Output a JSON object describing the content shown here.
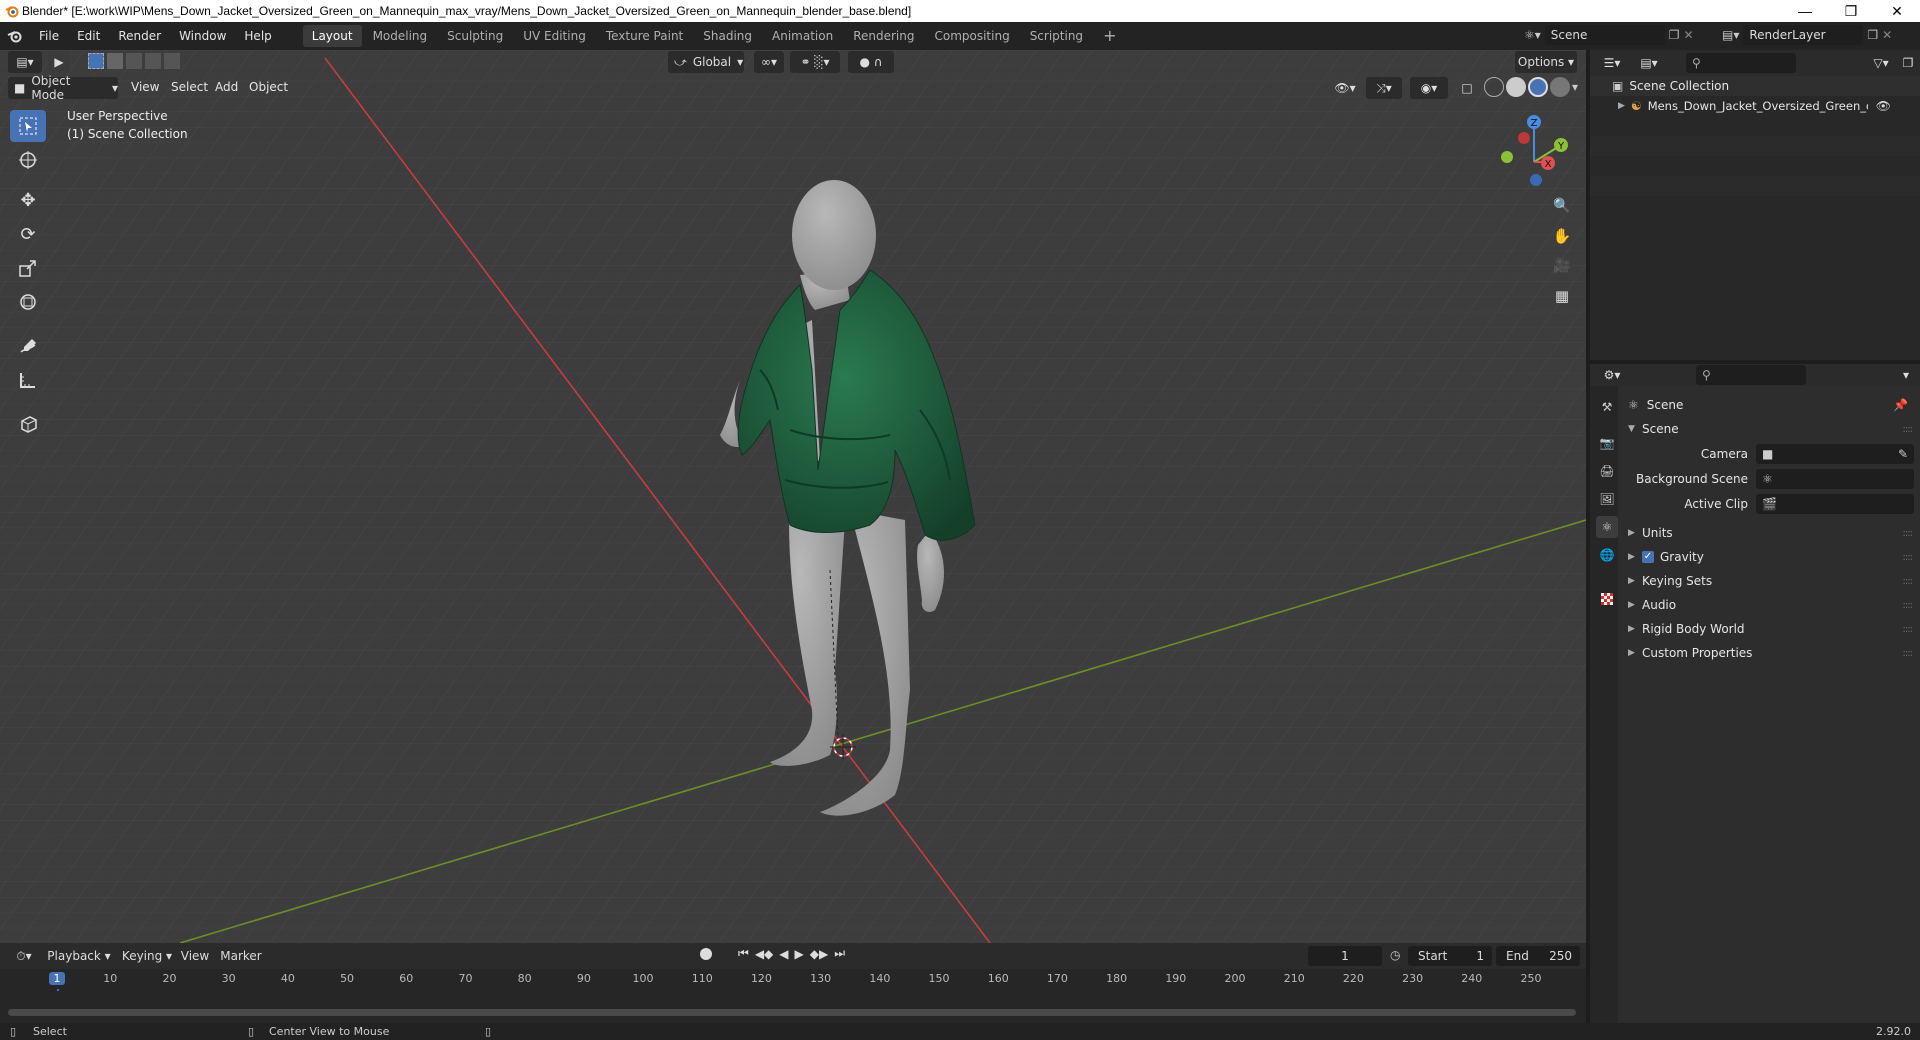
{
  "window": {
    "title": "Blender* [E:\\work\\WIP\\Mens_Down_Jacket_Oversized_Green_on_Mannequin_max_vray/Mens_Down_Jacket_Oversized_Green_on_Mannequin_blender_base.blend]"
  },
  "menu": [
    "File",
    "Edit",
    "Render",
    "Window",
    "Help"
  ],
  "workspaces": [
    "Layout",
    "Modeling",
    "Sculpting",
    "UV Editing",
    "Texture Paint",
    "Shading",
    "Animation",
    "Rendering",
    "Compositing",
    "Scripting"
  ],
  "active_workspace": "Layout",
  "scene_field": "Scene",
  "renderlayer_field": "RenderLayer",
  "viewport": {
    "mode": "Object Mode",
    "menus": [
      "View",
      "Select",
      "Add",
      "Object"
    ],
    "orientation": "Global",
    "options": "Options",
    "overlay_line1": "User Perspective",
    "overlay_line2": "(1) Scene Collection",
    "gizmo": {
      "z": "Z",
      "y": "Y",
      "x": "X"
    }
  },
  "outliner": {
    "collection": "Scene Collection",
    "item": "Mens_Down_Jacket_Oversized_Green_on_Ma"
  },
  "properties": {
    "header": "Scene",
    "panel": "Scene",
    "camera_label": "Camera",
    "bg_scene_label": "Background Scene",
    "active_clip_label": "Active Clip",
    "sections": [
      "Units",
      "Gravity",
      "Keying Sets",
      "Audio",
      "Rigid Body World",
      "Custom Properties"
    ],
    "gravity_checked": true
  },
  "timeline": {
    "menus": [
      "Playback",
      "Keying",
      "View",
      "Marker"
    ],
    "current_frame": "1",
    "start_label": "Start",
    "start_value": "1",
    "end_label": "End",
    "end_value": "250",
    "ruler": [
      "1",
      "10",
      "20",
      "30",
      "40",
      "50",
      "60",
      "70",
      "80",
      "90",
      "100",
      "110",
      "120",
      "130",
      "140",
      "150",
      "160",
      "170",
      "180",
      "190",
      "200",
      "210",
      "220",
      "230",
      "240",
      "250"
    ]
  },
  "status": {
    "left": "Select",
    "middle": "Center View to Mouse",
    "version": "2.92.0"
  },
  "colors": {
    "accent": "#4772b3",
    "jacket": "#1f5c3c",
    "x_axis": "#c83c3c",
    "y_axis": "#6b8f23"
  }
}
